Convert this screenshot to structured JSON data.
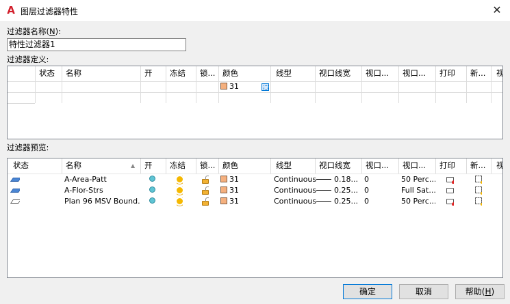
{
  "window": {
    "title": "图层过滤器特性",
    "close_glyph": "✕",
    "app_icon_glyph": "A"
  },
  "filter_name": {
    "label": "过滤器名称(",
    "mnemonic": "N",
    "label_end": "):",
    "value": "特性过滤器1"
  },
  "definition": {
    "label": "过滤器定义:",
    "columns": [
      "状态",
      "名称",
      "开",
      "冻结",
      "锁...",
      "颜色",
      "线型",
      "视口线宽",
      "视口...",
      "视口...",
      "打印",
      "新...",
      "视"
    ],
    "rows": [
      {
        "color": "31"
      }
    ]
  },
  "preview": {
    "label": "过滤器预览:",
    "columns": [
      "状态",
      "名称",
      "开",
      "冻结",
      "锁...",
      "颜色",
      "线型",
      "视口线宽",
      "视口...",
      "视口...",
      "打印",
      "新...",
      "视"
    ],
    "rows": [
      {
        "name": "A-Area-Patt",
        "color": "31",
        "linetype": "Continuous",
        "lineweight": "0.18...",
        "transparency": "0",
        "plot_style": "50 Perc...",
        "print_icon": "no-plot-printer-icon"
      },
      {
        "name": "A-Flor-Strs",
        "color": "31",
        "linetype": "Continuous",
        "lineweight": "0.25...",
        "transparency": "0",
        "plot_style": "Full Sat...",
        "print_icon": "printer-icon"
      },
      {
        "name": "Plan 96 MSV Bound...",
        "color": "31",
        "linetype": "Continuous",
        "lineweight": "0.25...",
        "transparency": "0",
        "plot_style": "50 Perc...",
        "print_icon": "no-plot-printer-icon"
      }
    ]
  },
  "buttons": {
    "ok": "确定",
    "cancel": "取消",
    "help": "帮助(",
    "help_mnemonic": "H",
    "help_end": ")"
  },
  "colors": {
    "swatch": "#f5b07e",
    "accent": "#0078d7"
  }
}
